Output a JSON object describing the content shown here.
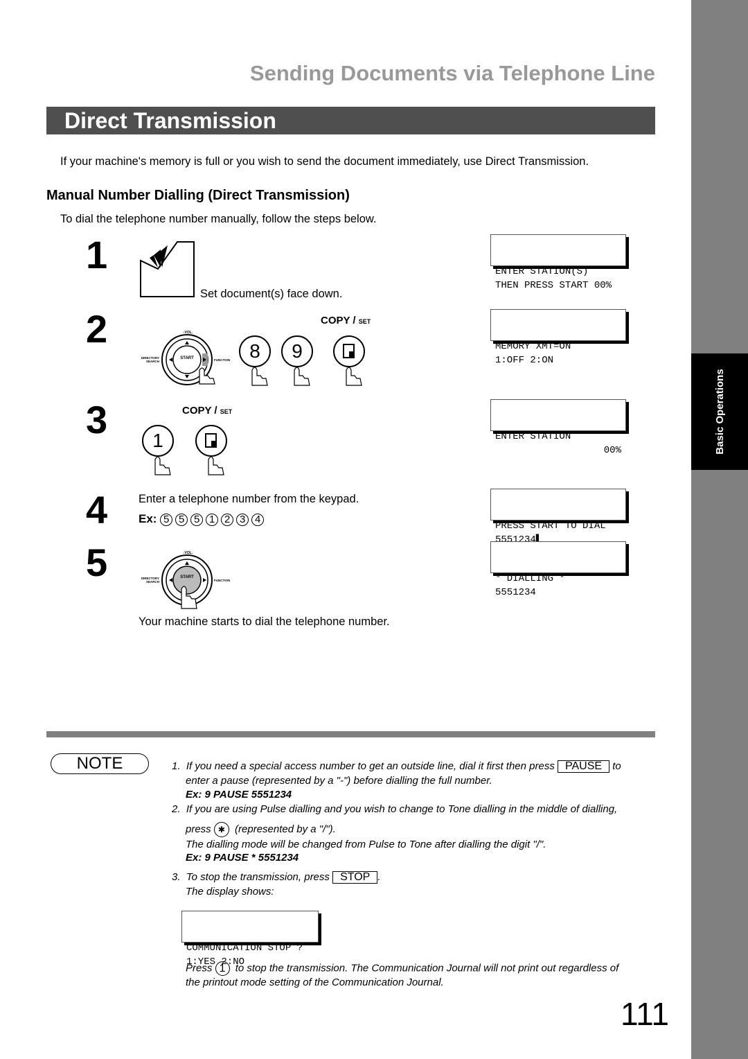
{
  "side_tab": {
    "label": "Basic Operations"
  },
  "header": {
    "chapter_title": "Sending Documents via Telephone Line",
    "section_title": "Direct Transmission"
  },
  "intro": "If your machine's memory is full or you wish to send the document immediately, use Direct Transmission.",
  "subsection": {
    "title": "Manual Number Dialling (Direct Transmission)",
    "lead": "To dial the telephone number manually, follow the steps below."
  },
  "steps": [
    {
      "num": "1",
      "text": "Set document(s) face down.",
      "lcd": [
        "ENTER STATION(S)",
        "THEN PRESS START 00%"
      ]
    },
    {
      "num": "2",
      "keys": [
        "8",
        "9"
      ],
      "copy_label": "COPY",
      "set_label": "SET",
      "lcd": [
        "MEMORY XMT=ON",
        "1:OFF 2:ON"
      ]
    },
    {
      "num": "3",
      "keys": [
        "1"
      ],
      "copy_label": "COPY",
      "set_label": "SET",
      "lcd": [
        "ENTER STATION",
        "00%"
      ]
    },
    {
      "num": "4",
      "text": "Enter a telephone number from the keypad.",
      "example_label": "Ex:",
      "example_digits": [
        "5",
        "5",
        "5",
        "1",
        "2",
        "3",
        "4"
      ],
      "lcd": [
        "PRESS START TO DIAL",
        "5551234▌"
      ]
    },
    {
      "num": "5",
      "text": "Your machine starts to dial the telephone number.",
      "lcd": [
        "* DIALLING *",
        "5551234"
      ]
    }
  ],
  "panel": {
    "vol": "↕VOL.",
    "start": "START",
    "directory": "DIRECTORY",
    "search": "SEARCH",
    "function": "FUNCTION"
  },
  "note": {
    "badge": "NOTE",
    "n1_num": "1.",
    "n1_a": "If you need a special access number to get an outside line, dial it first then press",
    "n1_key": "PAUSE",
    "n1_b": "to",
    "n1_c": "enter a pause (represented by a \"-\") before dialling the full number.",
    "n1_ex": "Ex: 9 PAUSE 5551234",
    "n2_num": "2.",
    "n2_a": "If you are using Pulse dialling and you wish to change to Tone dialling in the middle of dialling,",
    "n2_press": "press",
    "n2_key": "✱",
    "n2_b": "(represented by a \"/\").",
    "n2_c": "The dialling mode will be changed from Pulse to Tone after dialling the digit \"/\".",
    "n2_ex": "Ex: 9 PAUSE * 5551234",
    "n3_num": "3.",
    "n3_a": "To stop the transmission, press",
    "n3_key": "STOP",
    "n3_dot": ".",
    "n3_b": "The display shows:",
    "lcd": [
      "COMMUNICATION STOP ?",
      "1:YES 2:NO"
    ],
    "final_press": "Press",
    "final_key": "1",
    "final_a": "to stop the transmission. The Communication Journal will not print out regardless of",
    "final_b": "the printout mode setting of the Communication Journal."
  },
  "page_number": "111"
}
